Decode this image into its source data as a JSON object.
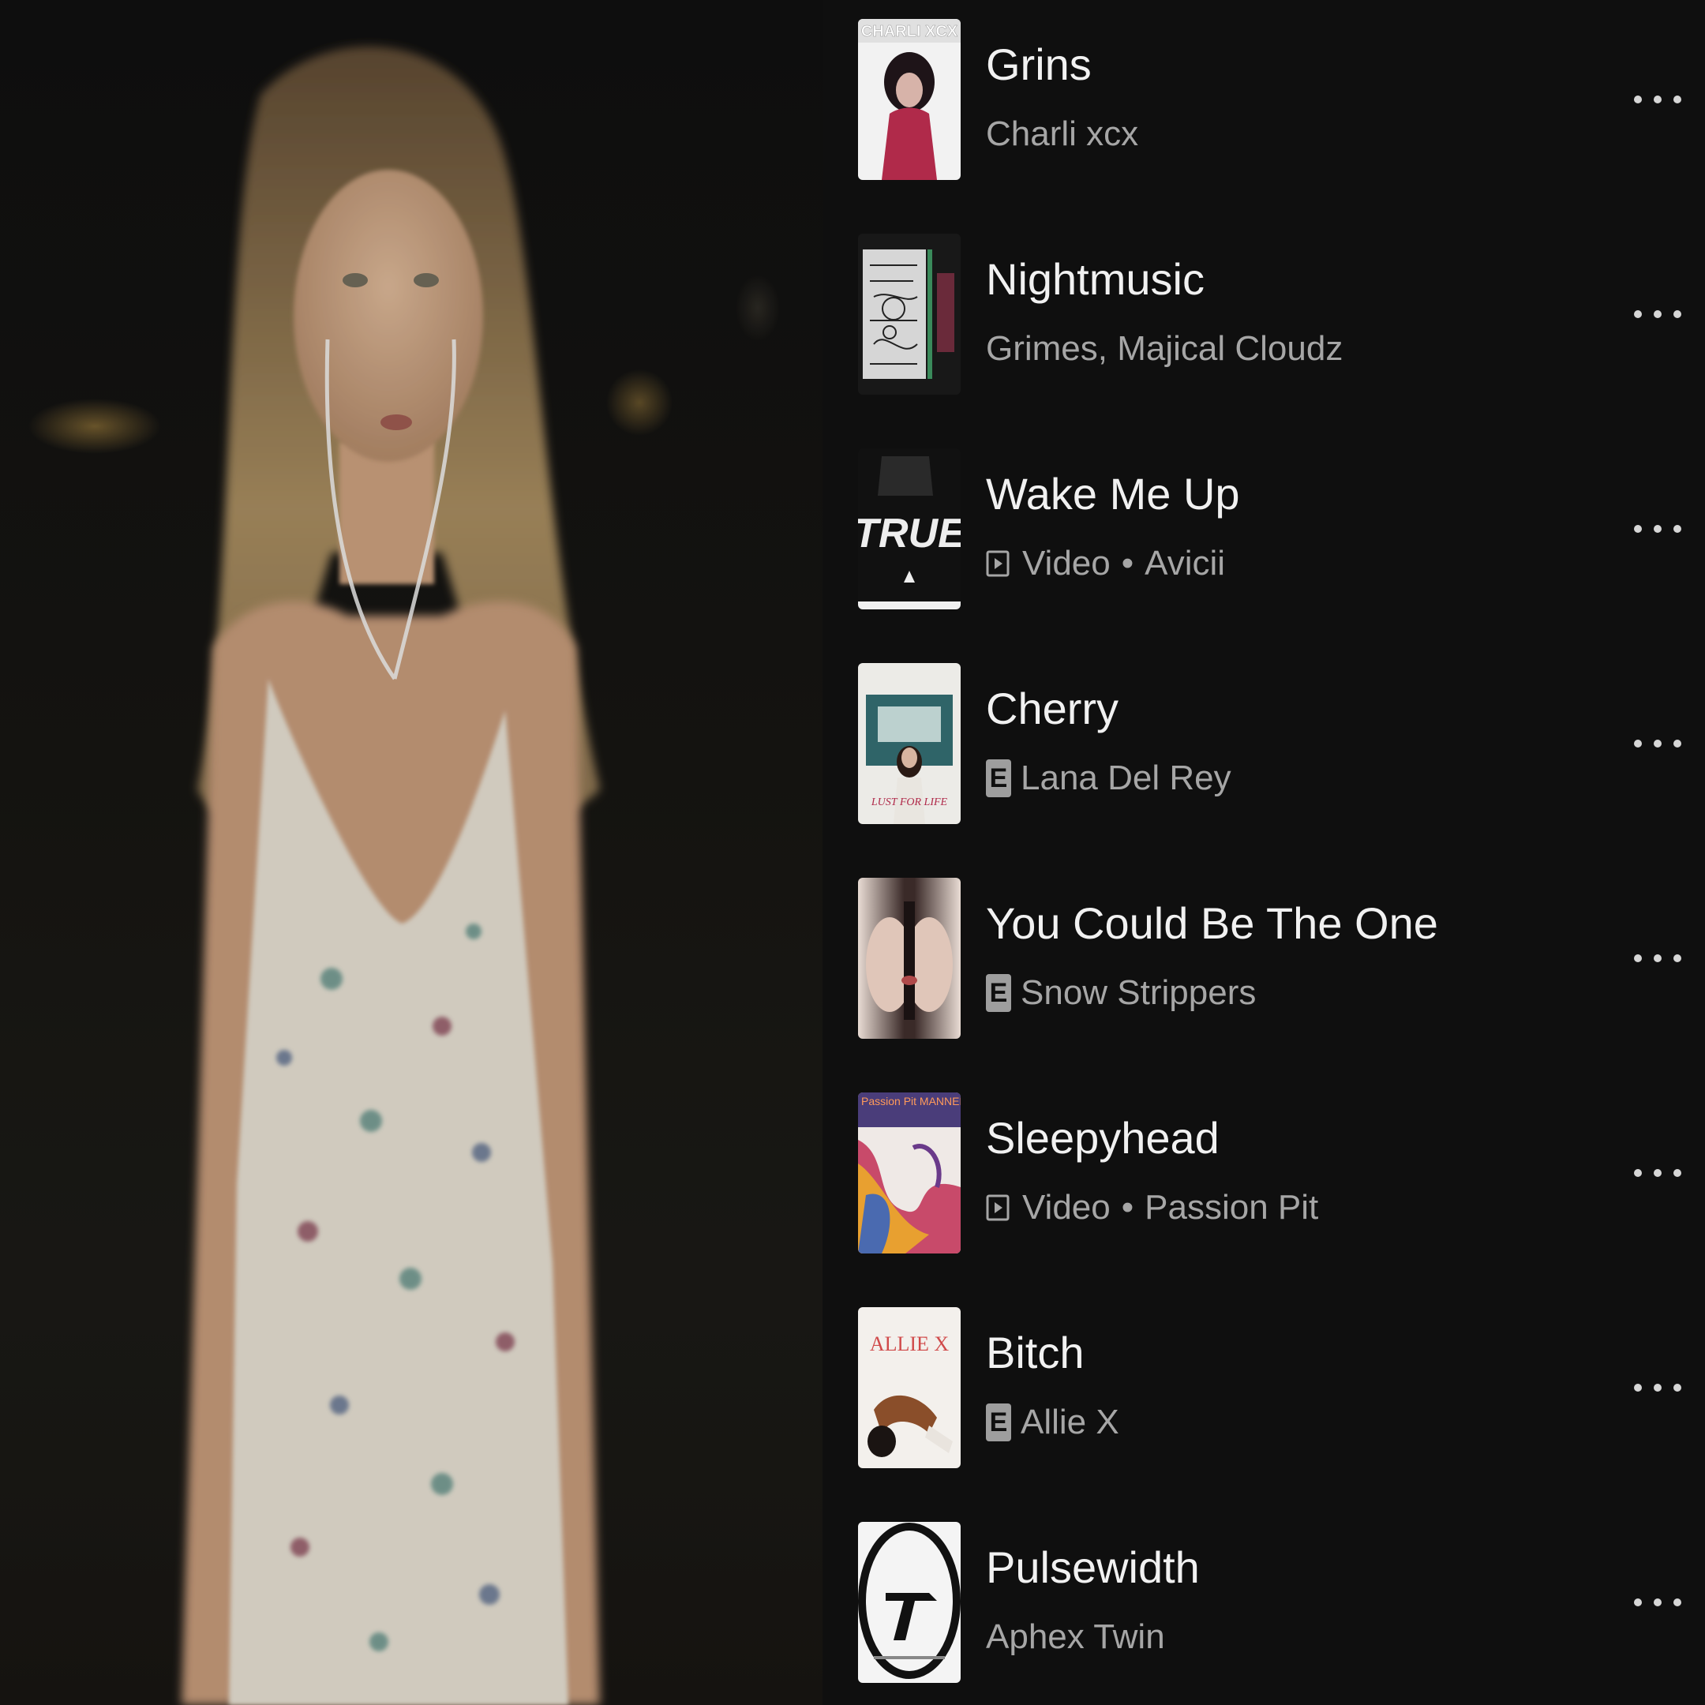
{
  "queue": {
    "items": [
      {
        "title": "Grins",
        "subtitle": "Charli xcx",
        "kind": "song",
        "explicit": false,
        "art_text": "CHARLI XCX"
      },
      {
        "title": "Nightmusic",
        "subtitle": "Grimes, Majical Cloudz",
        "kind": "song",
        "explicit": false,
        "art_text": ""
      },
      {
        "title": "Wake Me Up",
        "subtitle_type": "Video",
        "subtitle_sep": "•",
        "subtitle_artist": "Avicii",
        "kind": "video",
        "explicit": false,
        "art_text": "TRUE"
      },
      {
        "title": "Cherry",
        "subtitle": "Lana Del Rey",
        "kind": "song",
        "explicit": true,
        "explicit_label": "E",
        "art_text": "LUST FOR LIFE"
      },
      {
        "title": "You Could Be The One",
        "subtitle": "Snow Strippers",
        "kind": "song",
        "explicit": true,
        "explicit_label": "E",
        "art_text": ""
      },
      {
        "title": "Sleepyhead",
        "subtitle_type": "Video",
        "subtitle_sep": "•",
        "subtitle_artist": "Passion Pit",
        "kind": "video",
        "explicit": false,
        "art_text": "Passion Pit MANNERS"
      },
      {
        "title": "Bitch",
        "subtitle": "Allie X",
        "kind": "song",
        "explicit": true,
        "explicit_label": "E",
        "art_text": "ALLIE X"
      },
      {
        "title": "Pulsewidth",
        "subtitle": "Aphex Twin",
        "kind": "song",
        "explicit": false,
        "art_text": ""
      }
    ],
    "more_icon": "more-horizontal-icon",
    "video_icon": "play-box-icon"
  },
  "colors": {
    "background": "#0f0f0f",
    "title_text": "#f1f1f1",
    "subtitle_text": "#a6a6a6"
  }
}
